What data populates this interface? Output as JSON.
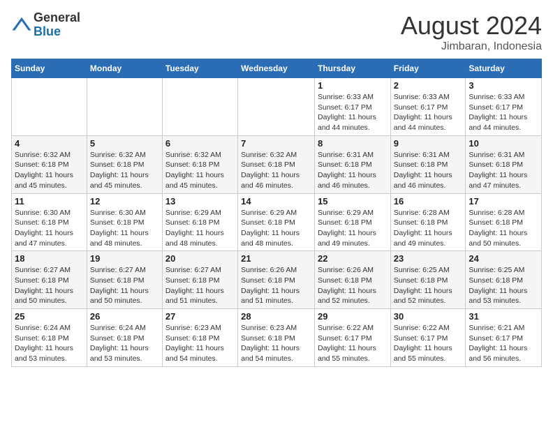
{
  "header": {
    "logo_general": "General",
    "logo_blue": "Blue",
    "month_year": "August 2024",
    "location": "Jimbaran, Indonesia"
  },
  "days_of_week": [
    "Sunday",
    "Monday",
    "Tuesday",
    "Wednesday",
    "Thursday",
    "Friday",
    "Saturday"
  ],
  "weeks": [
    [
      {
        "day": "",
        "info": ""
      },
      {
        "day": "",
        "info": ""
      },
      {
        "day": "",
        "info": ""
      },
      {
        "day": "",
        "info": ""
      },
      {
        "day": "1",
        "info": "Sunrise: 6:33 AM\nSunset: 6:17 PM\nDaylight: 11 hours and 44 minutes."
      },
      {
        "day": "2",
        "info": "Sunrise: 6:33 AM\nSunset: 6:17 PM\nDaylight: 11 hours and 44 minutes."
      },
      {
        "day": "3",
        "info": "Sunrise: 6:33 AM\nSunset: 6:17 PM\nDaylight: 11 hours and 44 minutes."
      }
    ],
    [
      {
        "day": "4",
        "info": "Sunrise: 6:32 AM\nSunset: 6:18 PM\nDaylight: 11 hours and 45 minutes."
      },
      {
        "day": "5",
        "info": "Sunrise: 6:32 AM\nSunset: 6:18 PM\nDaylight: 11 hours and 45 minutes."
      },
      {
        "day": "6",
        "info": "Sunrise: 6:32 AM\nSunset: 6:18 PM\nDaylight: 11 hours and 45 minutes."
      },
      {
        "day": "7",
        "info": "Sunrise: 6:32 AM\nSunset: 6:18 PM\nDaylight: 11 hours and 46 minutes."
      },
      {
        "day": "8",
        "info": "Sunrise: 6:31 AM\nSunset: 6:18 PM\nDaylight: 11 hours and 46 minutes."
      },
      {
        "day": "9",
        "info": "Sunrise: 6:31 AM\nSunset: 6:18 PM\nDaylight: 11 hours and 46 minutes."
      },
      {
        "day": "10",
        "info": "Sunrise: 6:31 AM\nSunset: 6:18 PM\nDaylight: 11 hours and 47 minutes."
      }
    ],
    [
      {
        "day": "11",
        "info": "Sunrise: 6:30 AM\nSunset: 6:18 PM\nDaylight: 11 hours and 47 minutes."
      },
      {
        "day": "12",
        "info": "Sunrise: 6:30 AM\nSunset: 6:18 PM\nDaylight: 11 hours and 48 minutes."
      },
      {
        "day": "13",
        "info": "Sunrise: 6:29 AM\nSunset: 6:18 PM\nDaylight: 11 hours and 48 minutes."
      },
      {
        "day": "14",
        "info": "Sunrise: 6:29 AM\nSunset: 6:18 PM\nDaylight: 11 hours and 48 minutes."
      },
      {
        "day": "15",
        "info": "Sunrise: 6:29 AM\nSunset: 6:18 PM\nDaylight: 11 hours and 49 minutes."
      },
      {
        "day": "16",
        "info": "Sunrise: 6:28 AM\nSunset: 6:18 PM\nDaylight: 11 hours and 49 minutes."
      },
      {
        "day": "17",
        "info": "Sunrise: 6:28 AM\nSunset: 6:18 PM\nDaylight: 11 hours and 50 minutes."
      }
    ],
    [
      {
        "day": "18",
        "info": "Sunrise: 6:27 AM\nSunset: 6:18 PM\nDaylight: 11 hours and 50 minutes."
      },
      {
        "day": "19",
        "info": "Sunrise: 6:27 AM\nSunset: 6:18 PM\nDaylight: 11 hours and 50 minutes."
      },
      {
        "day": "20",
        "info": "Sunrise: 6:27 AM\nSunset: 6:18 PM\nDaylight: 11 hours and 51 minutes."
      },
      {
        "day": "21",
        "info": "Sunrise: 6:26 AM\nSunset: 6:18 PM\nDaylight: 11 hours and 51 minutes."
      },
      {
        "day": "22",
        "info": "Sunrise: 6:26 AM\nSunset: 6:18 PM\nDaylight: 11 hours and 52 minutes."
      },
      {
        "day": "23",
        "info": "Sunrise: 6:25 AM\nSunset: 6:18 PM\nDaylight: 11 hours and 52 minutes."
      },
      {
        "day": "24",
        "info": "Sunrise: 6:25 AM\nSunset: 6:18 PM\nDaylight: 11 hours and 53 minutes."
      }
    ],
    [
      {
        "day": "25",
        "info": "Sunrise: 6:24 AM\nSunset: 6:18 PM\nDaylight: 11 hours and 53 minutes."
      },
      {
        "day": "26",
        "info": "Sunrise: 6:24 AM\nSunset: 6:18 PM\nDaylight: 11 hours and 53 minutes."
      },
      {
        "day": "27",
        "info": "Sunrise: 6:23 AM\nSunset: 6:18 PM\nDaylight: 11 hours and 54 minutes."
      },
      {
        "day": "28",
        "info": "Sunrise: 6:23 AM\nSunset: 6:18 PM\nDaylight: 11 hours and 54 minutes."
      },
      {
        "day": "29",
        "info": "Sunrise: 6:22 AM\nSunset: 6:17 PM\nDaylight: 11 hours and 55 minutes."
      },
      {
        "day": "30",
        "info": "Sunrise: 6:22 AM\nSunset: 6:17 PM\nDaylight: 11 hours and 55 minutes."
      },
      {
        "day": "31",
        "info": "Sunrise: 6:21 AM\nSunset: 6:17 PM\nDaylight: 11 hours and 56 minutes."
      }
    ]
  ]
}
